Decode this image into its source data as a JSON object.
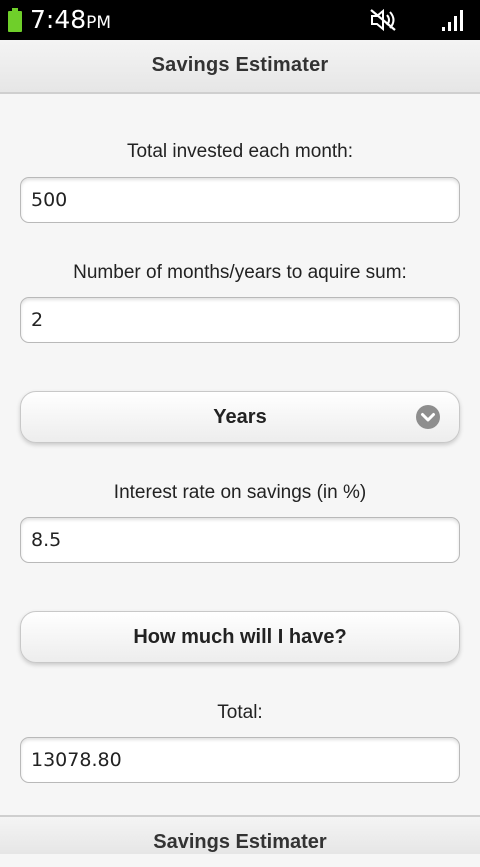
{
  "status_bar": {
    "time": "7:48",
    "ampm": "PM",
    "battery_color": "#6fcf2a",
    "icons": [
      "battery-icon",
      "mute-icon",
      "signal-icon"
    ]
  },
  "header": {
    "title": "Savings Estimater"
  },
  "form": {
    "monthly_label": "Total invested each month:",
    "monthly_value": "500",
    "duration_label": "Number of months/years to aquire sum:",
    "duration_value": "2",
    "period_select": "Years",
    "interest_label": "Interest rate on savings (in %)",
    "interest_value": "8.5",
    "calculate_button": "How much will I have?",
    "total_label": "Total:",
    "total_value": "13078.80"
  },
  "footer": {
    "title": "Savings Estimater"
  }
}
